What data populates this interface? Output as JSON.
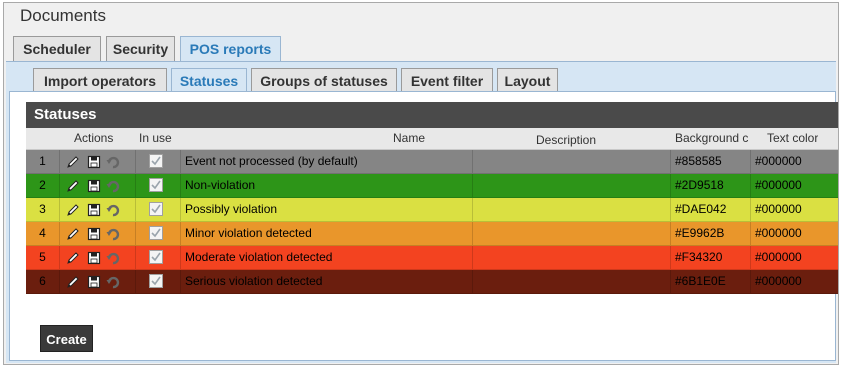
{
  "window_title": "Documents",
  "top_tabs": [
    {
      "label": "Scheduler",
      "active": false
    },
    {
      "label": "Security",
      "active": false
    },
    {
      "label": "POS reports",
      "active": true
    }
  ],
  "sub_tabs": [
    {
      "label": "Import operators",
      "active": false
    },
    {
      "label": "Statuses",
      "active": true
    },
    {
      "label": "Groups of statuses",
      "active": false
    },
    {
      "label": "Event filter",
      "active": false
    },
    {
      "label": "Layout",
      "active": false
    }
  ],
  "grid": {
    "title": "Statuses",
    "columns": {
      "actions": "Actions",
      "in_use": "In use",
      "name": "Name",
      "description": "Description",
      "background": "Background c",
      "text_color": "Text color"
    },
    "rows": [
      {
        "num": "1",
        "name": "Event not processed (by default)",
        "description": "",
        "background": "#858585",
        "text_color": "#000000",
        "in_use": true
      },
      {
        "num": "2",
        "name": "Non-violation",
        "description": "",
        "background": "#2D9518",
        "text_color": "#000000",
        "in_use": true
      },
      {
        "num": "3",
        "name": "Possibly violation",
        "description": "",
        "background": "#DAE042",
        "text_color": "#000000",
        "in_use": true
      },
      {
        "num": "4",
        "name": "Minor violation detected",
        "description": "",
        "background": "#E9962B",
        "text_color": "#000000",
        "in_use": true
      },
      {
        "num": "5",
        "name": "Moderate violation detected",
        "description": "",
        "background": "#F34320",
        "text_color": "#000000",
        "in_use": true
      },
      {
        "num": "6",
        "name": "Serious violation detected",
        "description": "",
        "background": "#6B1E0E",
        "text_color": "#000000",
        "in_use": true
      }
    ]
  },
  "create_label": "Create",
  "icons": {
    "edit": "pencil-icon",
    "save": "save-icon",
    "undo": "undo-icon",
    "check": "checkbox-icon"
  }
}
